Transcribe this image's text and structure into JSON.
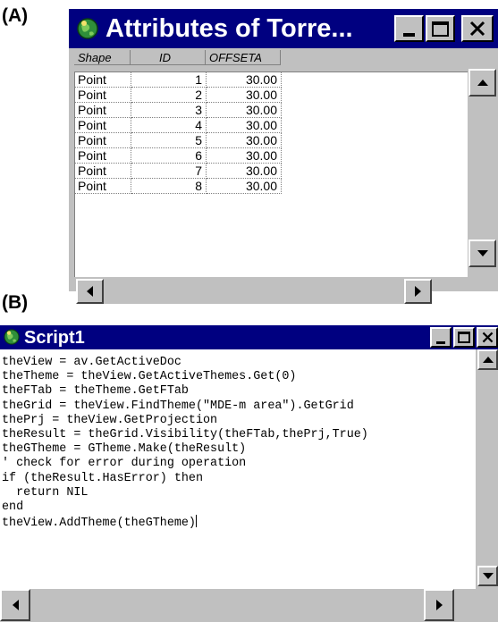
{
  "labels": {
    "a": "(A)",
    "b": "(B)"
  },
  "attributes_window": {
    "title": "Attributes of Torre...",
    "columns": [
      "Shape",
      "ID",
      "OFFSETA"
    ],
    "rows": [
      [
        "Point",
        "1",
        "30.00"
      ],
      [
        "Point",
        "2",
        "30.00"
      ],
      [
        "Point",
        "3",
        "30.00"
      ],
      [
        "Point",
        "4",
        "30.00"
      ],
      [
        "Point",
        "5",
        "30.00"
      ],
      [
        "Point",
        "6",
        "30.00"
      ],
      [
        "Point",
        "7",
        "30.00"
      ],
      [
        "Point",
        "8",
        "30.00"
      ]
    ]
  },
  "script_window": {
    "title": "Script1",
    "lines": [
      "theView = av.GetActiveDoc",
      "theTheme = theView.GetActiveThemes.Get(0)",
      "theFTab = theTheme.GetFTab",
      "theGrid = theView.FindTheme(\"MDE-m area\").GetGrid",
      "thePrj = theView.GetProjection",
      "theResult = theGrid.Visibility(theFTab,thePrj,True)",
      "theGTheme = GTheme.Make(theResult)",
      "' check for error during operation",
      "if (theResult.HasError) then",
      "  return NIL",
      "end",
      "theView.AddTheme(theGTheme)"
    ]
  },
  "colors": {
    "titlebar": "#000080",
    "chrome": "#c0c0c0"
  },
  "icons": [
    "globe-app-icon",
    "minimize-icon",
    "maximize-icon",
    "close-icon",
    "scroll-up-icon",
    "scroll-down-icon",
    "scroll-left-icon",
    "scroll-right-icon"
  ]
}
